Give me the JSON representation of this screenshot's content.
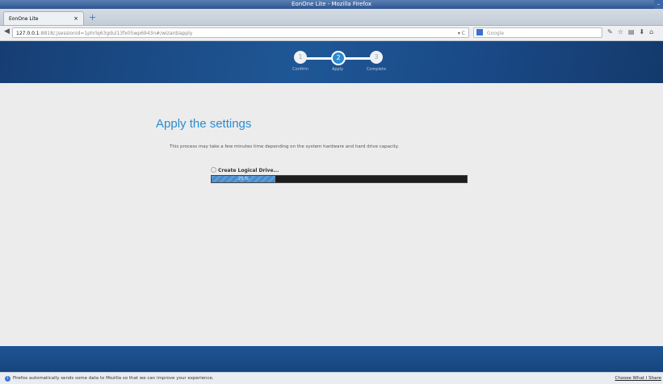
{
  "window": {
    "title": "EonOne Lite - Mozilla Firefox",
    "controls": "– □"
  },
  "tab": {
    "title": "EonOne Lite",
    "close_glyph": "×",
    "new_tab_glyph": "+"
  },
  "nav": {
    "back_glyph": "◀",
    "url_host": "127.0.0.1",
    "url_rest": ":8818/;jsessionid=1phrlq63gdul13fx05wp6943n#/wizard/apply",
    "url_controls": "▾ C",
    "search_placeholder": "Google",
    "toolbar_icons": "✎☆▤⬇⌂"
  },
  "wizard": {
    "steps": [
      {
        "number": "1",
        "label": "Confirm",
        "state": "done"
      },
      {
        "number": "2",
        "label": "Apply",
        "state": "active"
      },
      {
        "number": "3",
        "label": "Complete",
        "state": "pending"
      }
    ]
  },
  "main": {
    "title": "Apply the settings",
    "description": "This process may take a few minutes time depending on the system hardware and hard drive capacity.",
    "task_label": "Create Logical Drive...",
    "progress_fraction": 0.25,
    "progress_text": "25 %"
  },
  "notification": {
    "message": "Firefox automatically sends some data to Mozilla so that we can improve your experience.",
    "button": "Choose What I Share"
  },
  "colors": {
    "brand_blue": "#1f5796",
    "title_blue": "#2a8dd0",
    "progress_blue": "#5c9bd6"
  }
}
